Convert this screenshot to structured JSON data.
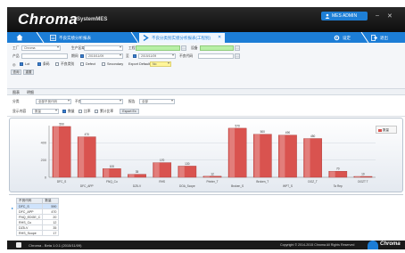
{
  "app": {
    "logo": "Chroma",
    "logo_sub": "SystemMES",
    "user": "MES ADMIN",
    "win_min": "–",
    "win_close": "✕"
  },
  "tabs": [
    {
      "label": "不良实绩分析报表"
    },
    {
      "label": "不良分类别实绩分析报表(工程别)"
    }
  ],
  "tab_right": [
    {
      "label": "设定"
    },
    {
      "label": "退出"
    }
  ],
  "form": {
    "row1": {
      "label_a": "工厂",
      "value_a": "Chroma",
      "label_b": "生产区域",
      "value_b": "",
      "label_c": "工程",
      "value_c": "",
      "label_d": "设备",
      "value_d": ""
    },
    "row2": {
      "label_a": "产品",
      "value_a": "",
      "label_b": "期间",
      "date_from": "2015/11/09",
      "date_to": "2015/11/09",
      "label_c": "至",
      "label_d": "不良代码",
      "value_d": ""
    },
    "row3": {
      "opt1": "Lot",
      "opt2": "条码",
      "opt3": "不良类别",
      "opt4": "Defect",
      "opt5": "Secondary",
      "label_e": "Export Default",
      "value_e": "No"
    },
    "row4": {
      "btn_search": "查询",
      "btn_reset": "重置"
    }
  },
  "sub_tabs": [
    "图表",
    "明细"
  ],
  "filters": {
    "label_a": "分类",
    "value_a": "全部不良代码",
    "label_b": "不良",
    "value_b": "",
    "label_c": "报告",
    "value_c": "全部"
  },
  "filters2": {
    "label_a": "显示内容",
    "value_a": "数量",
    "radio1": "数量",
    "radio2": "比率",
    "radio3": "累计比率",
    "btn_export": "Export Ex"
  },
  "chart_data": {
    "type": "bar",
    "ylim": [
      0,
      600
    ],
    "yticks": [
      0,
      200,
      400
    ],
    "categories": [
      "DFC_S",
      "DFC_APP",
      "FNQ_Cu",
      "DZ5-V",
      "RHS",
      "DOA_Scope",
      "Printer_T",
      "Broken_S",
      "Broken_T",
      "WPT_S",
      "DOZ_T",
      "Ta Rep",
      "DOZT T"
    ],
    "values": [
      590,
      470,
      100,
      35,
      170,
      130,
      12,
      570,
      500,
      490,
      450,
      70,
      10
    ],
    "legend": "数量"
  },
  "table": {
    "headers": [
      "不良代码",
      "数量"
    ],
    "rows": [
      {
        "code": "DFC_S",
        "qty": "590"
      },
      {
        "code": "DFC_APP",
        "qty": "470"
      },
      {
        "code": "FNQ_EDGE_C",
        "qty": "20"
      },
      {
        "code": "RHS_Cu",
        "qty": "12"
      },
      {
        "code": "DZ5-V",
        "qty": "35"
      },
      {
        "code": "RHS_Scope",
        "qty": "17"
      }
    ]
  },
  "status": {
    "left": "Chroma - Beta 1.0.1 (2015/11/09)",
    "right": "Copyright © 2014-2015 Chroma All Rights Reserved",
    "brand": "Chroma"
  },
  "colors": {
    "bar": "#d9534f",
    "accent": "#1c7dd6"
  }
}
